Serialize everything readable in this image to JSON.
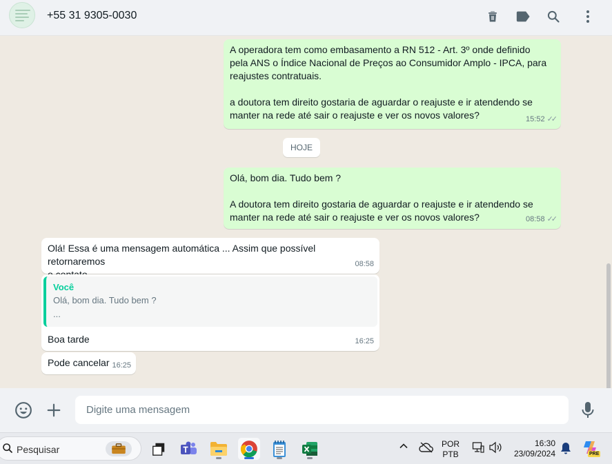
{
  "header": {
    "contact": "+55 31 9305-0030",
    "icons": [
      "delete-icon",
      "label-icon",
      "search-icon",
      "more-icon"
    ]
  },
  "messages": [
    {
      "direction": "out",
      "text": "A operadora tem como embasamento a RN 512 - Art. 3º onde definido\npela ANS o Índice Nacional de Preços ao Consumidor Amplo - IPCA, para\nreajustes contratuais.\n\na doutora tem direito gostaria de aguardar o reajuste e ir atendendo se\nmanter na rede até sair o reajuste e ver os novos valores?",
      "time": "15:52"
    },
    {
      "type": "date",
      "label": "HOJE"
    },
    {
      "direction": "out",
      "text": "Olá, bom dia. Tudo bem ?\n\nA doutora tem direito gostaria de aguardar o reajuste e ir atendendo se\nmanter na rede até sair o reajuste e ver os novos valores?",
      "time": "08:58"
    },
    {
      "direction": "in",
      "text": "Olá! Essa é uma mensagem automática ... Assim que possível retornaremos\no contato",
      "time": "08:58"
    },
    {
      "direction": "in",
      "quote": {
        "author": "Você",
        "text": "Olá, bom dia. Tudo bem ?\n..."
      },
      "text": "Boa tarde",
      "time": "16:25"
    },
    {
      "direction": "in",
      "text": "Pode cancelar",
      "time": "16:25"
    }
  ],
  "composer": {
    "placeholder": "Digite uma mensagem",
    "icons": [
      "emoji-icon",
      "plus-icon",
      "microphone-icon"
    ]
  },
  "taskbar": {
    "search_placeholder": "Pesquisar",
    "apps": [
      "work-briefcase-icon",
      "task-view-icon",
      "teams-icon",
      "file-explorer-icon",
      "chrome-icon",
      "notepad-icon",
      "excel-icon"
    ],
    "language_top": "POR",
    "language_bottom": "PTB",
    "time": "16:30",
    "date": "23/09/2024",
    "badge": "PRE"
  },
  "colors": {
    "outgoing_bubble": "#d9fdd3",
    "incoming_bubble": "#ffffff",
    "chat_background": "#efeae2",
    "accent": "#06cf9c"
  }
}
